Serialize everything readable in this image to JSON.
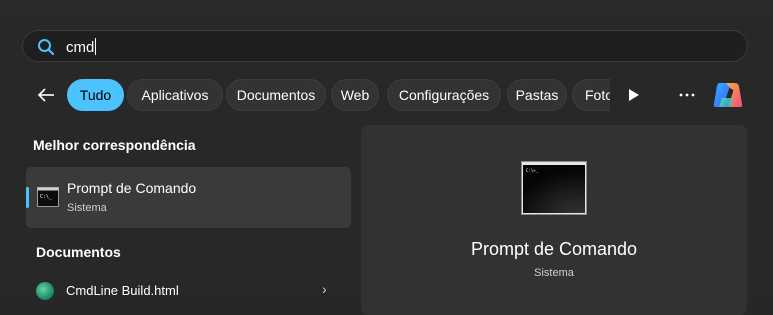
{
  "search": {
    "value": "cmd"
  },
  "filters": [
    {
      "label": "Tudo",
      "active": true
    },
    {
      "label": "Aplicativos",
      "active": false
    },
    {
      "label": "Documentos",
      "active": false
    },
    {
      "label": "Web",
      "active": false
    },
    {
      "label": "Configurações",
      "active": false
    },
    {
      "label": "Pastas",
      "active": false
    },
    {
      "label": "Fotos",
      "active": false
    }
  ],
  "best_match": {
    "heading": "Melhor correspondência",
    "title": "Prompt de Comando",
    "subtitle": "Sistema"
  },
  "documents": {
    "heading": "Documentos",
    "first_item": "CmdLine Build.html"
  },
  "preview": {
    "title": "Prompt de Comando",
    "subtitle": "Sistema"
  },
  "icons": [
    "search-icon",
    "back-arrow-icon",
    "play-icon",
    "more-icon",
    "copilot-icon",
    "command-prompt-icon",
    "edge-icon",
    "chevron-right-icon"
  ],
  "colors": {
    "accent": "#4cc2ff",
    "background": "#282828",
    "selected": "#3a3a3a"
  }
}
